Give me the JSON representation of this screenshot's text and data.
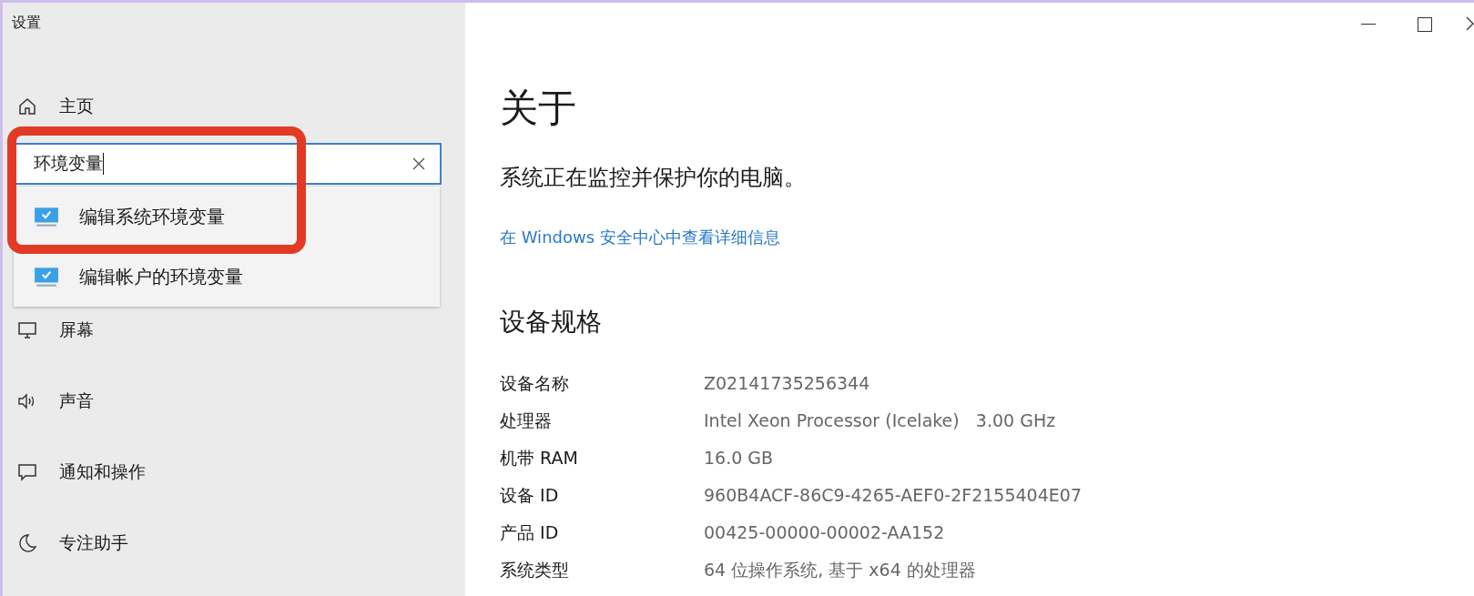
{
  "window": {
    "title": "设置"
  },
  "sidebar": {
    "home": {
      "label": "主页"
    },
    "search": {
      "value": "环境变量"
    },
    "suggestions": [
      {
        "label": "编辑系统环境变量",
        "highlighted": true
      },
      {
        "label": "编辑帐户的环境变量",
        "highlighted": false
      }
    ],
    "items": [
      {
        "label": "屏幕",
        "kind": "display"
      },
      {
        "label": "声音",
        "kind": "sound"
      },
      {
        "label": "通知和操作",
        "kind": "notification"
      },
      {
        "label": "专注助手",
        "kind": "moon"
      }
    ]
  },
  "page": {
    "title": "关于",
    "status": "系统正在监控并保护你的电脑。",
    "link": "在 Windows 安全中心中查看详细信息",
    "section": "设备规格",
    "specs": [
      {
        "label": "设备名称",
        "value": "Z02141735256344"
      },
      {
        "label": "处理器",
        "value": "Intel Xeon Processor (Icelake)   3.00 GHz"
      },
      {
        "label": "机带 RAM",
        "value": "16.0 GB"
      },
      {
        "label": "设备 ID",
        "value": "960B4ACF-86C9-4265-AEF0-2F2155404E07"
      },
      {
        "label": "产品 ID",
        "value": "00425-00000-00002-AA152"
      },
      {
        "label": "系统类型",
        "value": "64 位操作系统, 基于 x64 的处理器"
      }
    ]
  }
}
